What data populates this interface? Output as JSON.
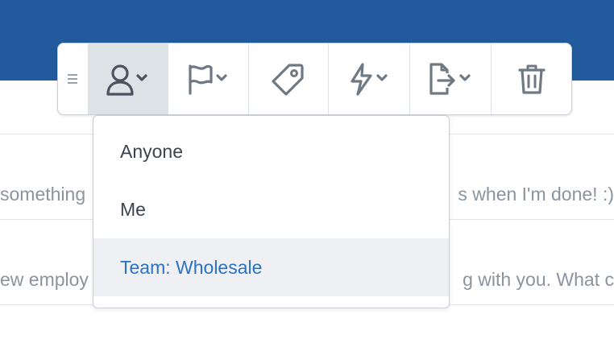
{
  "app": {
    "accent_color": "#225a9e",
    "selected_color": "#2b72c2"
  },
  "toolbar": {
    "handle_icon": "drag-handle-icon",
    "buttons": [
      {
        "name": "assign",
        "icon": "person-icon",
        "has_caret": true,
        "active": true
      },
      {
        "name": "flag",
        "icon": "flag-icon",
        "has_caret": true,
        "active": false
      },
      {
        "name": "tag",
        "icon": "tag-icon",
        "has_caret": false,
        "active": false
      },
      {
        "name": "workflow",
        "icon": "lightning-icon",
        "has_caret": true,
        "active": false
      },
      {
        "name": "move",
        "icon": "move-document-icon",
        "has_caret": true,
        "active": false
      },
      {
        "name": "delete",
        "icon": "trash-icon",
        "has_caret": false,
        "active": false
      }
    ]
  },
  "assign_menu": {
    "items": [
      {
        "label": "Anyone",
        "selected": false
      },
      {
        "label": "Me",
        "selected": false
      },
      {
        "label": "Team: Wholesale",
        "selected": true
      }
    ]
  },
  "background_list": {
    "rows": [
      {
        "left_text": "something",
        "right_text": "s when I'm done! :)"
      },
      {
        "left_text": "ew employ",
        "right_text": "g with you. What c"
      }
    ]
  }
}
